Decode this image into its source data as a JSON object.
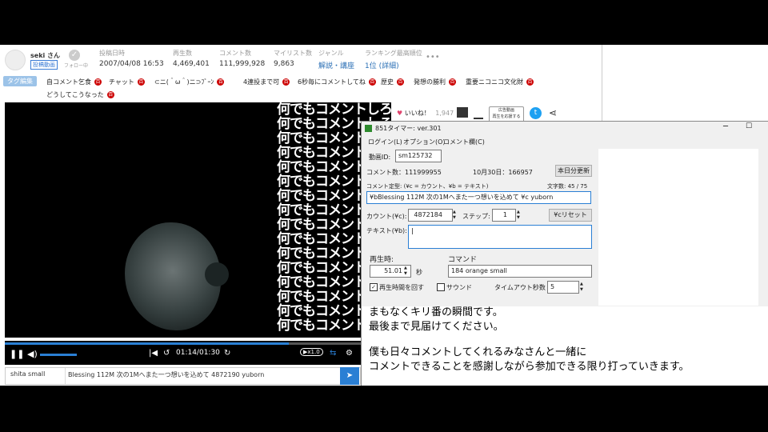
{
  "uploader": {
    "name": "seki さん",
    "badge": "投稿動画",
    "follow": "フォロー中"
  },
  "stats": [
    {
      "label": "投稿日時",
      "value": "2007/04/08 16:53"
    },
    {
      "label": "再生数",
      "value": "4,469,401"
    },
    {
      "label": "コメント数",
      "value": "111,999,928"
    },
    {
      "label": "マイリスト数",
      "value": "9,863"
    },
    {
      "label": "ジャンル",
      "value": "解説・講座"
    },
    {
      "label": "ランキング最高順位",
      "value": "1位 (詳細)"
    }
  ],
  "tag_edit": "タグ編集",
  "tags": [
    "自コメント乞食",
    "チャット",
    "⊂ニ(＾ω＾)ニ⊃ﾌﾞｰﾝ",
    "4連投まで可",
    "6秒毎にコメントしてね",
    "歴史",
    "発想の勝利",
    "重要ニコニコ文化財",
    "どうしてこうなった"
  ],
  "dic_mark": "百",
  "actions": {
    "like": "いいね！",
    "like_count": "1,947",
    "ad": "再生を応援する",
    "ad2": "広告動画"
  },
  "video": {
    "comment_text": "何でもコメントしろ",
    "time": "01:14/01:30",
    "speed": "x1.0"
  },
  "comment_input": {
    "command": "shita small",
    "text": "Blessing 112M 次の1Mへまた一つ想いを込めて 4872190 yuborn"
  },
  "timer": {
    "title": "851タイマー: ver.301",
    "menu": [
      "ログイン(L)",
      "オプション(O)",
      "コメント欄(C)"
    ],
    "video_id_label": "動画ID:",
    "video_id": "sm125732",
    "comment_count": "コメント数：111999955",
    "today": "10月30日：166957",
    "refresh_btn": "本日分更新",
    "define_label": "コメント定型: (¥c = カウント、¥b = テキスト)",
    "char_count": "文字数: 45 / 75",
    "template": "¥bBlessing 112M 次の1Mへまた一つ想いを込めて ¥c yuborn",
    "count_label": "カウント(¥c):",
    "count": "4872184",
    "step_label": "ステップ:",
    "step": "1",
    "reset_btn": "¥cリセット",
    "text_label": "テキスト(¥b):",
    "play_time_label": "再生時:",
    "play_time": "51.01",
    "sec": "秒",
    "command_label": "コマンド",
    "command": "184 orange small",
    "loop_label": "再生時間を回す",
    "sound_label": "サウンド",
    "timeout_label": "タイムアウト秒数",
    "timeout": "5"
  },
  "overlay": {
    "line1": "まもなくキリ番の瞬間です。",
    "line2": "最後まで見届けてください。",
    "line3": "僕も日々コメントしてくれるみなさんと一緒に",
    "line4": "コメントできることを感謝しながら参加できる限り打っていきます。"
  }
}
